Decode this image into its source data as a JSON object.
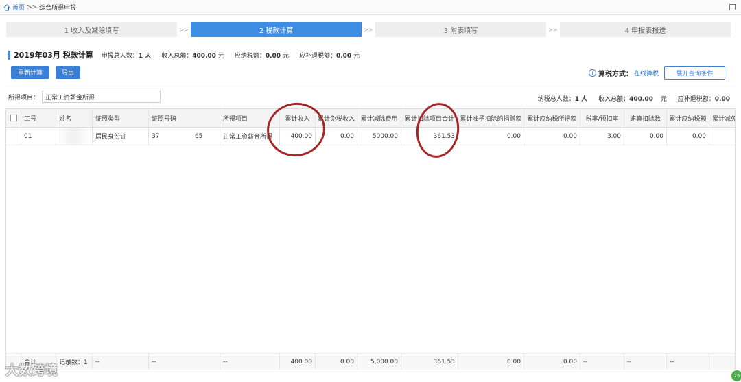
{
  "breadcrumb": {
    "home": "首页",
    "separator": ">>",
    "current": "综合所得申报"
  },
  "steps": [
    {
      "label": "1 收入及减除填写",
      "active": false
    },
    {
      "label": "2 税款计算",
      "active": true
    },
    {
      "label": "3 附表填写",
      "active": false
    },
    {
      "label": "4 申报表报送",
      "active": false
    }
  ],
  "step_arrow": ">>",
  "summary": {
    "title": "2019年03月 税款计算",
    "declarants_label": "申报总人数：",
    "declarants_value": "1 人",
    "income_label": "收入总额：",
    "income_value": "400.00",
    "income_unit": "元",
    "tax_payable_label": "应纳税额：",
    "tax_payable_value": "0.00",
    "tax_payable_unit": "元",
    "refund_label": "应补退税额：",
    "refund_value": "0.00",
    "refund_unit": "元"
  },
  "buttons": {
    "recalc": "重新计算",
    "export": "导出",
    "expand": "展开查询条件"
  },
  "calc_method": {
    "label": "算税方式：",
    "value": "在线算税"
  },
  "income_type": {
    "label": "所得项目：",
    "value": "正常工资薪金所得"
  },
  "right_summary": {
    "taxpayers": "纳税总人数：",
    "taxpayers_value": "1 人",
    "income": "收入总额：",
    "income_value": "400.00",
    "income_unit": "元",
    "refund": "应补退税额：",
    "refund_value": "0.00"
  },
  "table": {
    "headers": [
      "工号",
      "姓名",
      "证照类型",
      "证照号码",
      "所得项目",
      "累计收入",
      "累计免税收入",
      "累计减除费用",
      "累计扣除项目合计",
      "累计准予扣除的捐赠额",
      "累计应纳税所得额",
      "税率/预扣率",
      "速算扣除数",
      "累计应纳税额",
      "累计减免"
    ],
    "rows": [
      [
        "01",
        "",
        "居民身份证",
        "37                  65",
        "正常工资薪金所得",
        "400.00",
        "0.00",
        "5000.00",
        "361.53",
        "0.00",
        "0.00",
        "3.00",
        "0.00",
        "0.00",
        ""
      ]
    ],
    "totals": [
      "合计",
      "记录数：1",
      "--",
      "--",
      "--",
      "400.00",
      "0.00",
      "5,000.00",
      "361.53",
      "0.00",
      "0.00",
      "--",
      "--",
      "--",
      ""
    ]
  },
  "watermark": "大数跨境",
  "corner_badge": "75",
  "colors": {
    "accent": "#3f8ee6",
    "annotation": "#a82525"
  }
}
